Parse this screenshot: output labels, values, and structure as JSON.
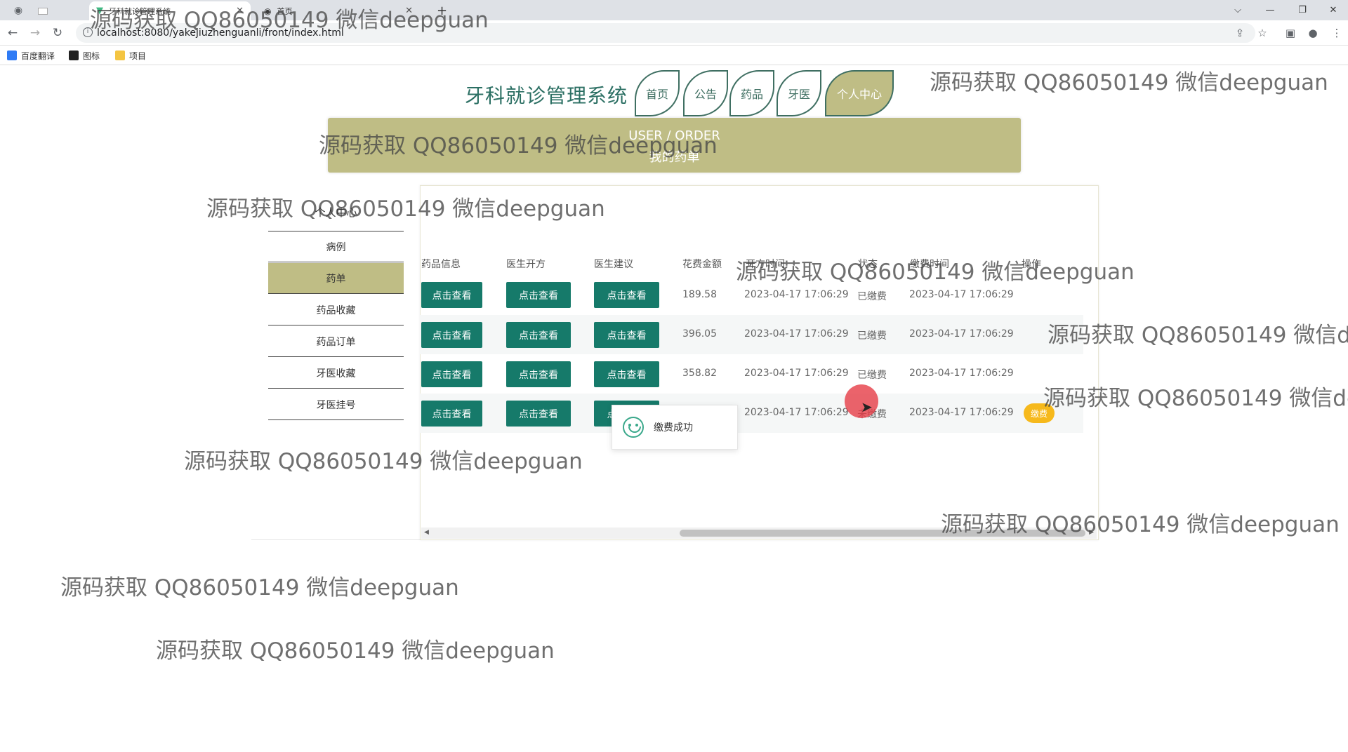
{
  "browser": {
    "tabs": [
      {
        "title": "",
        "active": false
      },
      {
        "title": "牙科就诊管理系统",
        "active": true
      },
      {
        "title": "首页",
        "active": false
      }
    ],
    "new_tab": "+",
    "url": "localhost:8080/yakejiuzhenguanli/front/index.html",
    "bookmarks": [
      "百度翻译",
      "图标",
      "项目"
    ],
    "window_controls": {
      "minimize": "—",
      "restore": "❐",
      "close": "✕",
      "dropdown": "⌵"
    }
  },
  "site": {
    "title": "牙科就诊管理系统",
    "nav": [
      "首页",
      "公告",
      "药品",
      "牙医",
      "个人中心"
    ],
    "active_nav": "个人中心"
  },
  "banner": {
    "en": "USER / ORDER",
    "cn": "我的药单"
  },
  "sidebar": {
    "title": "个人中心",
    "items": [
      "病例",
      "药单",
      "药品收藏",
      "药品订单",
      "牙医收藏",
      "牙医挂号"
    ],
    "active": "药单"
  },
  "table": {
    "headers": [
      "药品信息",
      "医生开方",
      "医生建议",
      "花费金额",
      "开方时间",
      "状态",
      "缴费时间",
      "操作"
    ],
    "view_label": "点击查看",
    "rows": [
      {
        "amount": "189.58",
        "time": "2023-04-17 17:06:29",
        "status": "已缴费",
        "paid_time": "2023-04-17 17:06:29",
        "action": ""
      },
      {
        "amount": "396.05",
        "time": "2023-04-17 17:06:29",
        "status": "已缴费",
        "paid_time": "2023-04-17 17:06:29",
        "action": ""
      },
      {
        "amount": "358.82",
        "time": "2023-04-17 17:06:29",
        "status": "已缴费",
        "paid_time": "2023-04-17 17:06:29",
        "action": ""
      },
      {
        "amount": "",
        "time": "2023-04-17 17:06:29",
        "status": "未缴费",
        "paid_time": "2023-04-17 17:06:29",
        "action": "缴费"
      }
    ]
  },
  "toast": {
    "message": "缴费成功",
    "icon": "smile-icon"
  },
  "watermark": "源码获取 QQ86050149 微信deepguan",
  "colors": {
    "accent": "#167a6a",
    "banner": "#bfbd85",
    "title": "#2b6f63",
    "pay": "#f6b91c"
  }
}
